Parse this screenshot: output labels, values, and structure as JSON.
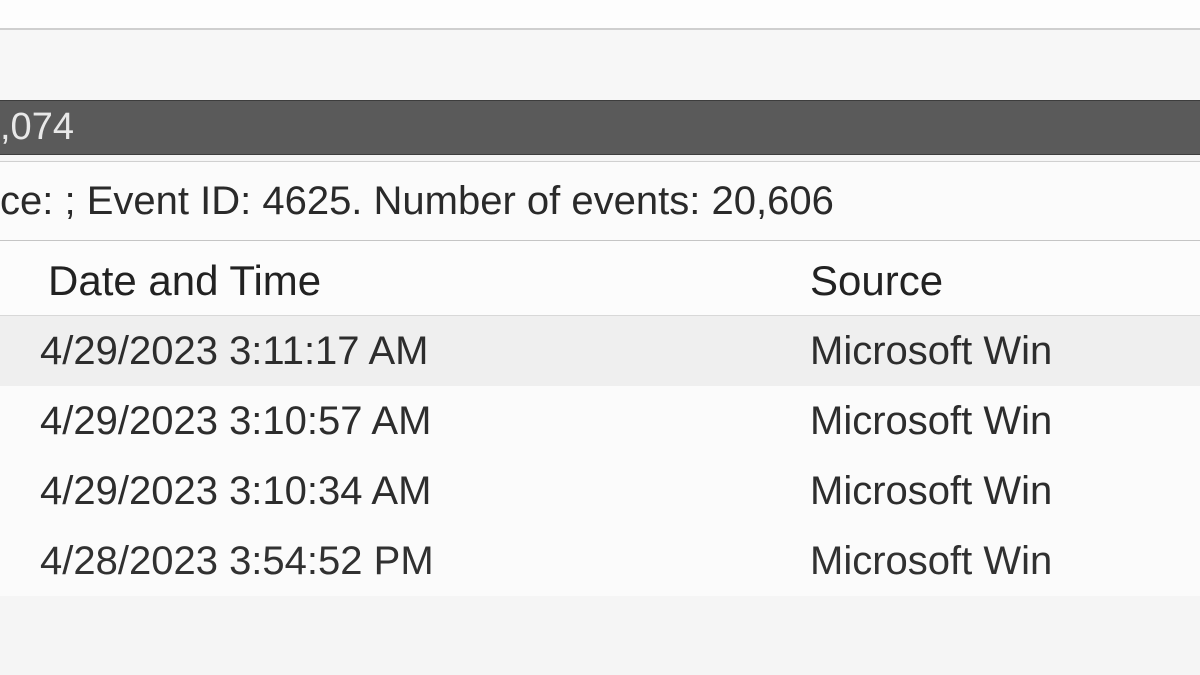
{
  "count_bar": {
    "partial_text": ",074"
  },
  "filter": {
    "partial_text": "ce: ; Event ID: 4625. Number of events: 20,606"
  },
  "columns": {
    "date": "Date and Time",
    "source": "Source"
  },
  "rows": [
    {
      "date": "4/29/2023 3:11:17 AM",
      "source": "Microsoft Win"
    },
    {
      "date": "4/29/2023 3:10:57 AM",
      "source": "Microsoft Win"
    },
    {
      "date": "4/29/2023 3:10:34 AM",
      "source": "Microsoft Win"
    },
    {
      "date": "4/28/2023 3:54:52 PM",
      "source": "Microsoft Win"
    }
  ]
}
